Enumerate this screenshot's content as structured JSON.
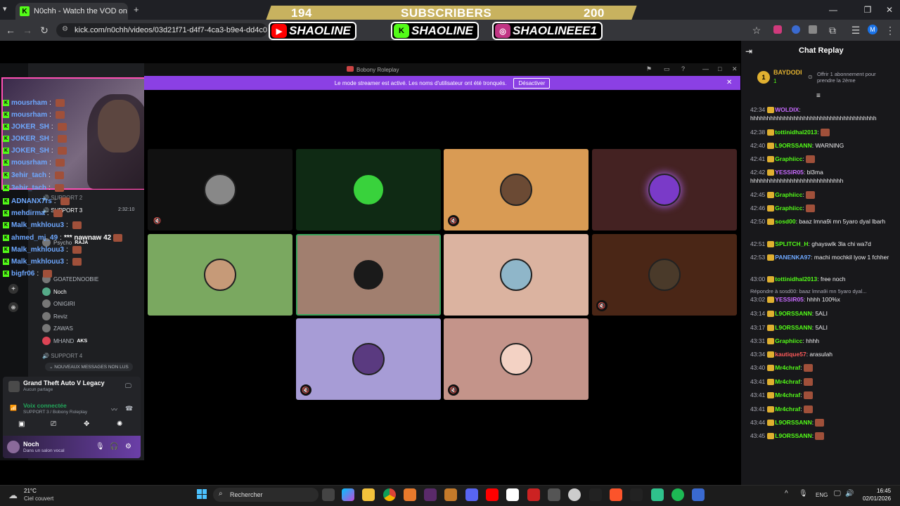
{
  "browser": {
    "tab_title": "N0chh - Watch the VOD on",
    "url": "kick.com/n0chh/videos/03d21f71-d4f7-4ca3-b9e4-dd4c0c97f576",
    "profile_initial": "M"
  },
  "overlay": {
    "subs_current": "194",
    "subs_label": "SUBSCRIBERS",
    "subs_goal": "200",
    "youtube": "SHAOLINE",
    "kick": "SHAOLINE",
    "instagram": "SHAOLINEEE1"
  },
  "discord": {
    "window_title": "Bobony Roleplay",
    "streamer_notice": "Le mode streamer est activé. Les noms d'utilisateur ont été tronqués.",
    "disable_button": "Désactiver",
    "sidebar": {
      "support2": "SUPPORT 2",
      "support3": "SUPPORT 3",
      "support3_time": "2:32:10",
      "members": [
        "GOATEDNOOBIE",
        "Noch",
        "ONIGIRI",
        "Reviz",
        "ZAWAS",
        "MHAND",
        "Psycho"
      ],
      "member_tag_raja": "RAJA",
      "member_tag_aks": "AKS",
      "support4": "SUPPORT 4",
      "new_messages": "NOUVEAUX MESSAGES NON LUS",
      "activity_title": "Grand Theft Auto V Legacy",
      "activity_sub": "Aucun partage",
      "voice_connected": "Voix connectée",
      "voice_channel": "SUPPORT 3 / Bobony Roleplay",
      "user_name": "Noch",
      "user_status": "Dans un salon vocal"
    }
  },
  "overlay_chat": [
    {
      "name": "mousrham",
      "text": ""
    },
    {
      "name": "mousrham",
      "text": ""
    },
    {
      "name": "JOKER_SH",
      "text": ""
    },
    {
      "name": "JOKER_SH",
      "text": ""
    },
    {
      "name": "JOKER_SH",
      "text": ""
    },
    {
      "name": "mousrham",
      "text": ""
    },
    {
      "name": "3ehir_tach",
      "text": ""
    },
    {
      "name": "3ehir_tach",
      "text": ""
    },
    {
      "name": "ADNANX7rs",
      "text": ""
    },
    {
      "name": "mehdirma",
      "text": ""
    },
    {
      "name": "Malk_mkhlouu3",
      "text": ""
    },
    {
      "name": "ahmed_mj_49",
      "text": "*** nawnaw 42"
    },
    {
      "name": "Malk_mkhlouu3",
      "text": ""
    },
    {
      "name": "Malk_mkhlouu3",
      "text": ""
    },
    {
      "name": "bigfr06",
      "text": ""
    }
  ],
  "chat_replay": {
    "title": "Chat Replay",
    "top_gifter": {
      "name": "BAYDODI",
      "rank": "1",
      "count": "1",
      "promo": "Offrir 1 abonnement pour prendre la 2ème"
    },
    "messages": [
      {
        "ts": "42:34",
        "user": "WOLDIX",
        "color": "#c86bff",
        "text": "hhhhhhhhhhhhhhhhhhhhhhhhhhhhhhhhhhhhhh"
      },
      {
        "ts": "42:38",
        "user": "tottinidhal2013",
        "color": "#53fc18",
        "text": ""
      },
      {
        "ts": "42:40",
        "user": "L9ORSSANN",
        "color": "#53fc18",
        "text": "WARNING"
      },
      {
        "ts": "42:41",
        "user": "Graphiicc",
        "color": "#53fc18",
        "text": ""
      },
      {
        "ts": "42:42",
        "user": "YESSIR05",
        "color": "#c86bff",
        "text": "bl3ma hhhhhhhhhhhhhhhhhhhhhhhhhhhh"
      },
      {
        "ts": "42:45",
        "user": "Graphiicc",
        "color": "#53fc18",
        "text": ""
      },
      {
        "ts": "42:46",
        "user": "Graphiicc",
        "color": "#53fc18",
        "text": ""
      },
      {
        "ts": "42:50",
        "user": "sosd00",
        "color": "#53fc18",
        "text": "baaz lmna9i mn 5yaro dyal lbarh"
      },
      {
        "ts": "42:51",
        "user": "SPLITCH_H",
        "color": "#53fc18",
        "text": "ghayswlk 3la chi wa7d"
      },
      {
        "ts": "42:53",
        "user": "PANENKA97",
        "color": "#6ea8ff",
        "text": "machi mochkil lyow 1 fchher"
      },
      {
        "ts": "43:00",
        "user": "tottinidhal2013",
        "color": "#53fc18",
        "text": "free noch"
      },
      {
        "ts": "43:02",
        "user": "YESSIR05",
        "color": "#c86bff",
        "text": "hhhh 100%x",
        "reply": "Répondre à sosd00: baaz lmna9i mn 5yaro dyal..."
      },
      {
        "ts": "43:14",
        "user": "L9ORSSANN",
        "color": "#53fc18",
        "text": "5ALI"
      },
      {
        "ts": "43:17",
        "user": "L9ORSSANN",
        "color": "#53fc18",
        "text": "5ALI"
      },
      {
        "ts": "43:31",
        "user": "Graphiicc",
        "color": "#53fc18",
        "text": "hhhh"
      },
      {
        "ts": "43:34",
        "user": "kautique57",
        "color": "#ff5a5a",
        "text": "arasulah"
      },
      {
        "ts": "43:40",
        "user": "Mr4chraf",
        "color": "#53fc18",
        "text": ""
      },
      {
        "ts": "43:41",
        "user": "Mr4chraf",
        "color": "#53fc18",
        "text": ""
      },
      {
        "ts": "43:41",
        "user": "Mr4chraf",
        "color": "#53fc18",
        "text": ""
      },
      {
        "ts": "43:41",
        "user": "Mr4chraf",
        "color": "#53fc18",
        "text": ""
      },
      {
        "ts": "43:44",
        "user": "L9ORSSANN",
        "color": "#53fc18",
        "text": ""
      },
      {
        "ts": "43:45",
        "user": "L9ORSSANN",
        "color": "#53fc18",
        "text": ""
      }
    ]
  },
  "taskbar": {
    "weather_temp": "21°C",
    "weather_desc": "Ciel couvert",
    "search": "Rechercher",
    "lang": "ENG",
    "time": "16:45",
    "date": "02/01/2026"
  }
}
